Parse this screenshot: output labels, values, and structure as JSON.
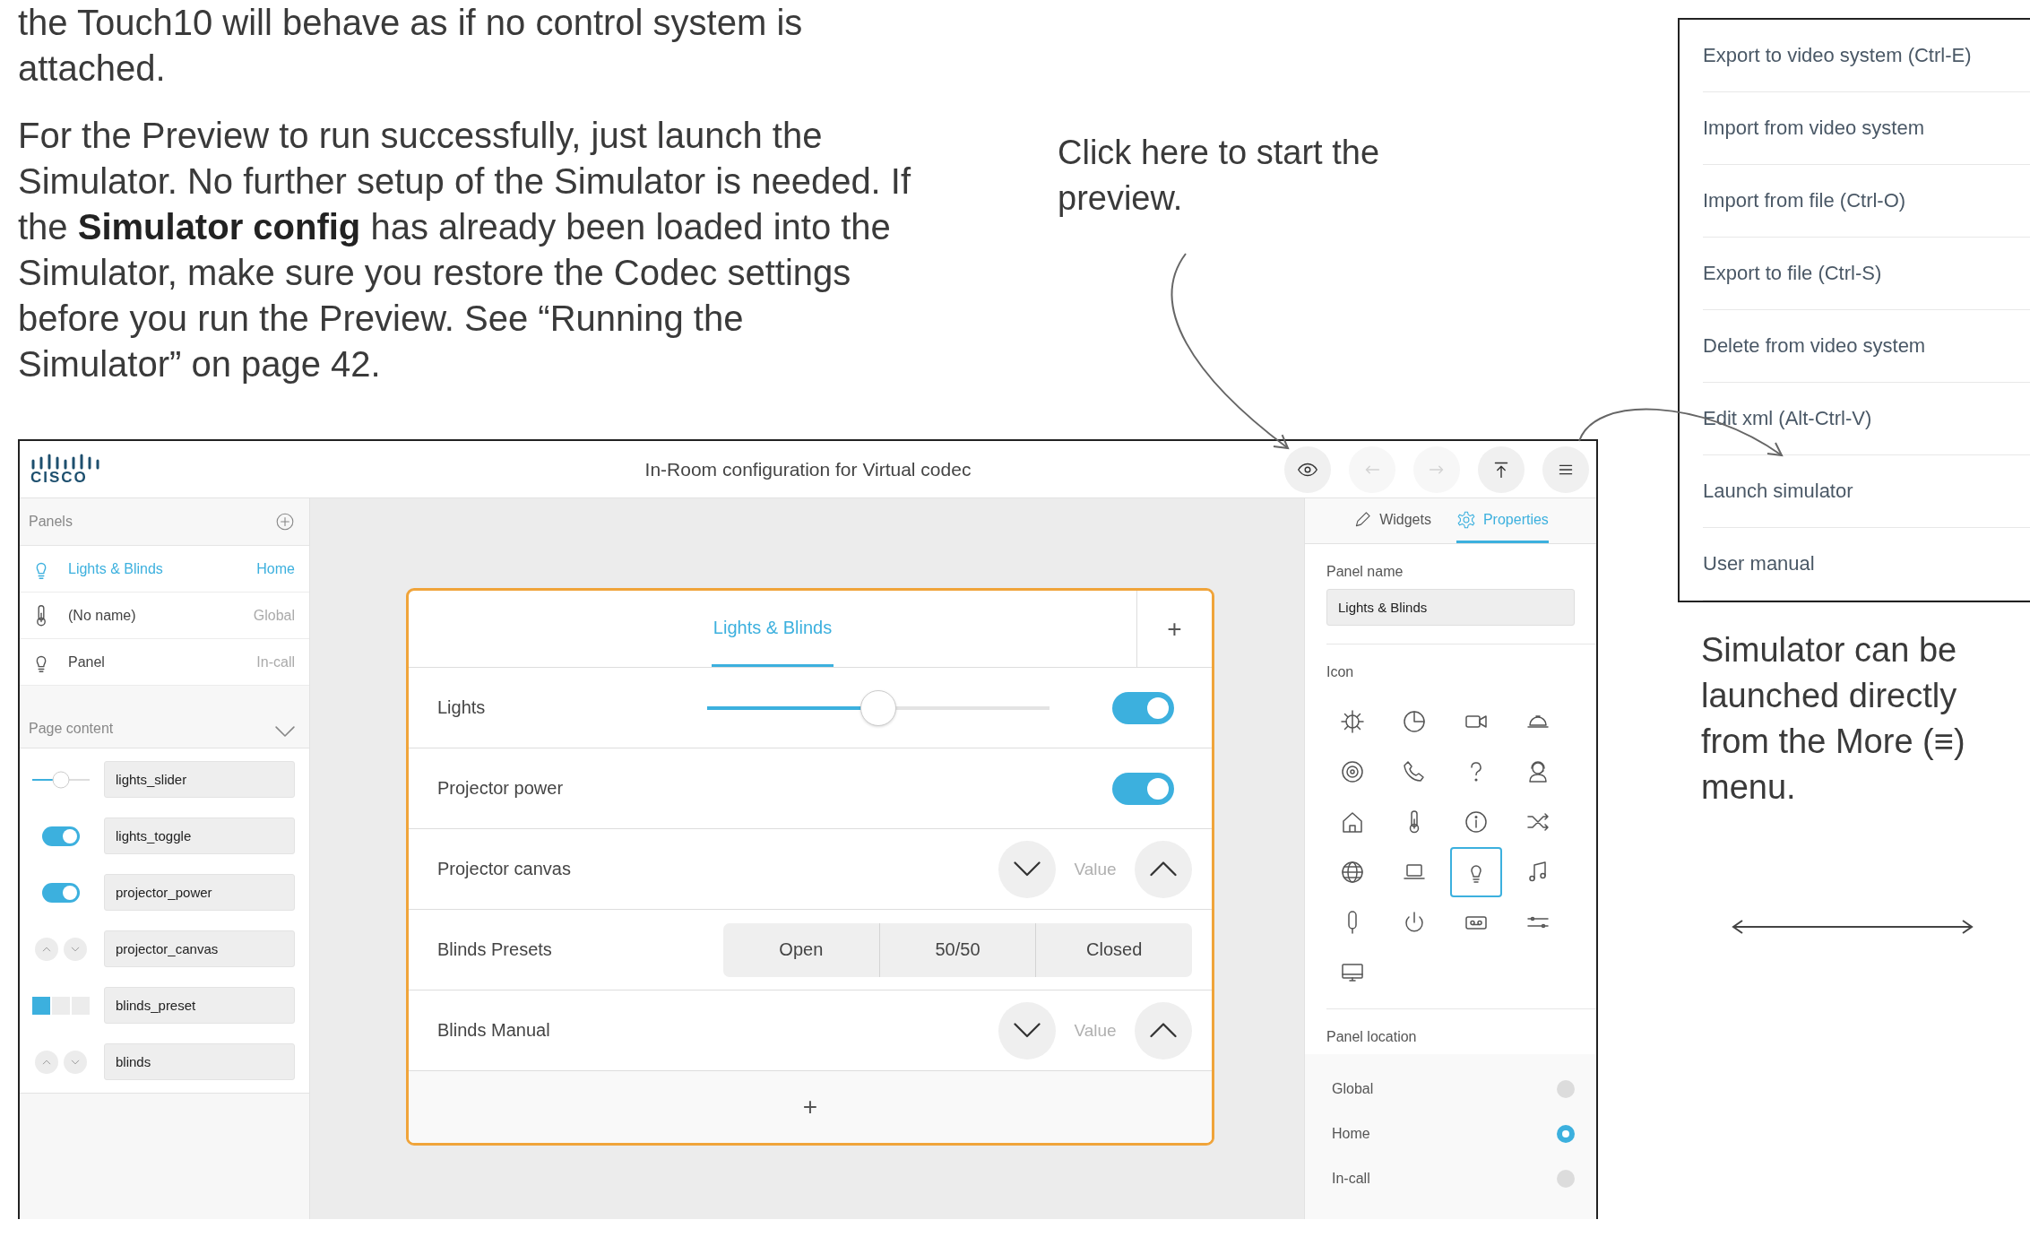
{
  "document": {
    "intro_text": "the Touch10 will behave as if no control system is attached.",
    "body_text": "For the Preview to run successfully, just launch the Simulator. No further setup of the Simulator is needed. If the **Simulator config** has already been loaded into the Simulator, make sure you restore the Codec settings before you run the Preview. See “Running the Simulator” on page 42.",
    "preview_callout": "Click here to start the preview.",
    "menu_note": "Simulator can be launched directly from the More (≡) menu."
  },
  "more_menu": {
    "items": [
      {
        "label": "Export to video system (Ctrl-E)"
      },
      {
        "label": "Import from video system"
      },
      {
        "label": "Import from file (Ctrl-O)"
      },
      {
        "label": "Export to file (Ctrl-S)"
      },
      {
        "label": "Delete from video system"
      },
      {
        "label": "Edit xml (Alt-Ctrl-V)"
      },
      {
        "label": "Launch simulator"
      },
      {
        "label": "User manual"
      }
    ]
  },
  "editor": {
    "logo": "CISCO",
    "title": "In-Room configuration for Virtual codec",
    "toolbar": [
      {
        "disabled": false
      },
      {
        "disabled": true
      },
      {
        "disabled": true
      },
      {
        "disabled": false
      },
      {
        "disabled": false
      }
    ],
    "sidebar": {
      "panels_heading": "Panels",
      "panels": [
        {
          "name": "Lights & Blinds",
          "location": "Home",
          "selected": true
        },
        {
          "name": "(No name)",
          "location": "Global",
          "selected": false
        },
        {
          "name": "Panel",
          "location": "In-call",
          "selected": false
        }
      ],
      "content_heading": "Page content",
      "widgets": [
        {
          "kind": "slider",
          "id": "lights_slider"
        },
        {
          "kind": "toggle",
          "id": "lights_toggle"
        },
        {
          "kind": "toggle",
          "id": "projector_power"
        },
        {
          "kind": "spinner",
          "id": "projector_canvas"
        },
        {
          "kind": "buttons",
          "id": "blinds_preset"
        },
        {
          "kind": "spinner",
          "id": "blinds"
        }
      ]
    },
    "canvas": {
      "tabs": [
        {
          "label": "Lights & Blinds",
          "selected": true
        }
      ],
      "add_tab": "+",
      "rows": [
        {
          "label": "Lights",
          "kind": "slider",
          "level": 0.5,
          "on": true
        },
        {
          "label": "Projector power",
          "kind": "toggle",
          "on": true
        },
        {
          "label": "Projector canvas",
          "kind": "spinner",
          "value": "Value"
        },
        {
          "label": "Blinds Presets",
          "kind": "buttons",
          "buttons": [
            {
              "label": "Open",
              "selected": false
            },
            {
              "label": "50/50",
              "selected": false
            },
            {
              "label": "Closed",
              "selected": false
            }
          ]
        },
        {
          "label": "Blinds Manual",
          "kind": "spinner",
          "value": "Value"
        }
      ],
      "add_row": "+"
    },
    "properties": {
      "tabs": [
        {
          "label": "Widgets",
          "selected": false
        },
        {
          "label": "Properties",
          "selected": true
        }
      ],
      "panel_name_label": "Panel name",
      "panel_name": "Lights & Blinds",
      "icon_label": "Icon",
      "icons": [
        {
          "selected": false
        },
        {
          "selected": false
        },
        {
          "selected": false
        },
        {
          "selected": false
        },
        {
          "selected": false
        },
        {
          "selected": false
        },
        {
          "selected": false
        },
        {
          "selected": false
        },
        {
          "selected": false
        },
        {
          "selected": false
        },
        {
          "selected": false
        },
        {
          "selected": false
        },
        {
          "selected": false
        },
        {
          "selected": false
        },
        {
          "selected": true
        },
        {
          "selected": false
        },
        {
          "selected": false
        },
        {
          "selected": false
        },
        {
          "selected": false
        },
        {
          "selected": false
        },
        {
          "selected": false
        }
      ],
      "location_label": "Panel location",
      "locations": [
        {
          "label": "Global",
          "selected": false
        },
        {
          "label": "Home",
          "selected": true
        },
        {
          "label": "In-call",
          "selected": false
        }
      ]
    }
  }
}
